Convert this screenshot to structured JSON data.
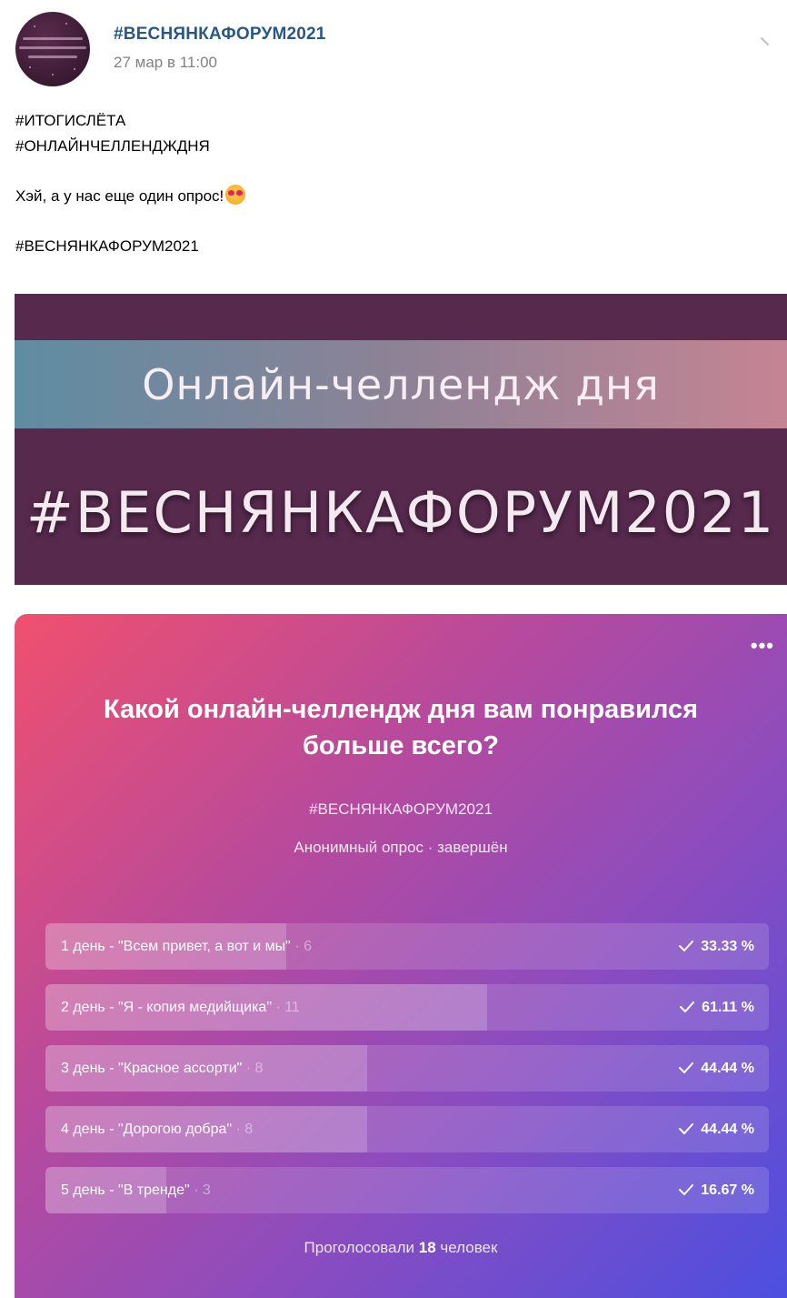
{
  "post": {
    "author": "#ВЕСНЯНКАФОРУМ2021",
    "date": "27 мар в 11:00",
    "text_lines": [
      "#ИТОГИСЛЁТА",
      "#ОНЛАЙНЧЕЛЛЕНДЖДНЯ"
    ],
    "greeting": "Хэй, а у нас еще один опрос!",
    "hashtag": "#ВЕСНЯНКАФОРУМ2021"
  },
  "banner": {
    "title": "Онлайн-челлендж дня",
    "tag": "#ВЕСНЯНКАФОРУМ2021"
  },
  "poll": {
    "more_label": "•••",
    "question": "Какой онлайн-челлендж дня вам понравился больше всего?",
    "hashtag": "#ВЕСНЯНКАФОРУМ2021",
    "meta": "Анонимный опрос · завершён",
    "options": [
      {
        "label": "1 день - \"Всем привет, а вот и мы\"",
        "count": "6",
        "percent": "33.33 %",
        "fraction": 0.3333
      },
      {
        "label": "2 день - \"Я - копия медийщика\"",
        "count": "11",
        "percent": "61.11 %",
        "fraction": 0.6111
      },
      {
        "label": "3 день - \"Красное ассорти\"",
        "count": "8",
        "percent": "44.44 %",
        "fraction": 0.4444
      },
      {
        "label": "4 день - \"Дорогою добра\"",
        "count": "8",
        "percent": "44.44 %",
        "fraction": 0.4444
      },
      {
        "label": "5 день - \"В тренде\"",
        "count": "3",
        "percent": "16.67 %",
        "fraction": 0.1667
      }
    ],
    "footer_prefix": "Проголосовали",
    "footer_count": "18",
    "footer_suffix": "человек"
  },
  "colors": {
    "link": "#2a5885",
    "banner_bg": "#56294d",
    "poll_gradient_start": "#f0506e",
    "poll_gradient_end": "#4c4fe0"
  },
  "icons": [
    "chevron-down-icon",
    "check-icon",
    "more-icon",
    "heart-eyes-emoji-icon"
  ]
}
